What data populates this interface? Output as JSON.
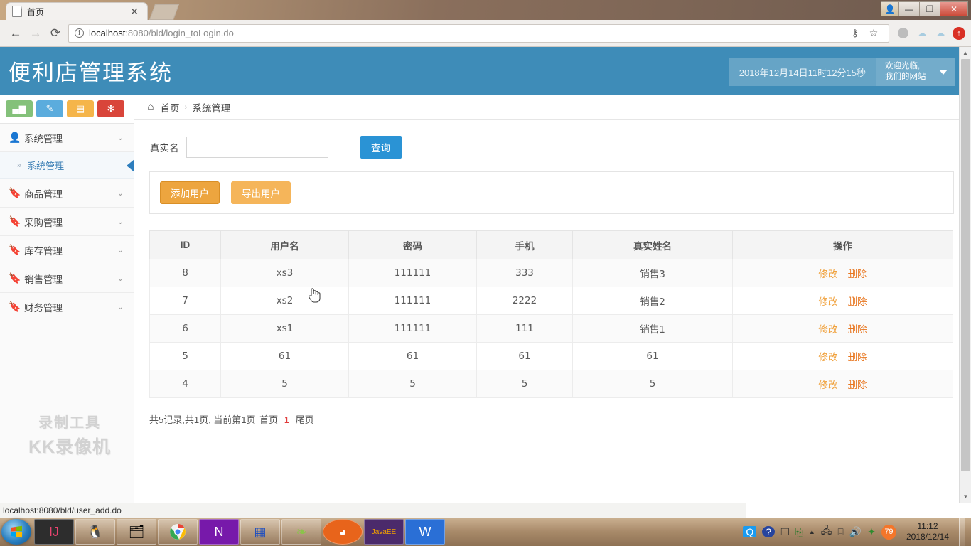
{
  "browser": {
    "tab_title": "首页",
    "tab_close": "✕",
    "back_icon": "←",
    "forward_icon": "→",
    "reload_icon": "⟳",
    "url_host": "localhost",
    "url_rest": ":8080/bld/login_toLogin.do",
    "key_icon": "⚷",
    "star_icon": "☆",
    "cloud_icon": "☁",
    "upload_icon": "↑",
    "minimize_icon": "—",
    "maximize_icon": "❐",
    "close_icon": "✕",
    "user_icon": "👤",
    "status_text": "localhost:8080/bld/user_add.do"
  },
  "header": {
    "title": "便利店管理系统",
    "datetime": "2018年12月14日11时12分15秒",
    "welcome_line1": "欢迎光临,",
    "welcome_line2": "我们的网站"
  },
  "sidebar": {
    "quick_icons": [
      {
        "name": "chart-icon",
        "glyph": "▮▬",
        "color": "#84c17a"
      },
      {
        "name": "pencil-icon",
        "glyph": "✎",
        "color": "#5bacdd"
      },
      {
        "name": "gift-icon",
        "glyph": "🎁",
        "color": "#f5b54a"
      },
      {
        "name": "gears-icon",
        "glyph": "✿",
        "color": "#d9453a"
      }
    ],
    "items": [
      {
        "label": "系统管理",
        "icon": "user-icon",
        "chevron": "⌄"
      },
      {
        "label": "商品管理",
        "icon": "bookmark-icon",
        "chevron": "⌄"
      },
      {
        "label": "采购管理",
        "icon": "bookmark-icon",
        "chevron": "⌄"
      },
      {
        "label": "库存管理",
        "icon": "bookmark-icon",
        "chevron": "⌄"
      },
      {
        "label": "销售管理",
        "icon": "bookmark-icon",
        "chevron": "⌄"
      },
      {
        "label": "财务管理",
        "icon": "bookmark-icon",
        "chevron": "⌄"
      }
    ],
    "sub_item": {
      "label": "系统管理",
      "arrow": "»"
    },
    "watermark_line1": "录制工具",
    "watermark_line2": "KK录像机"
  },
  "breadcrumb": {
    "home_icon": "⌂",
    "home": "首页",
    "separator": "›",
    "current": "系统管理"
  },
  "search": {
    "label": "真实名",
    "value": "",
    "placeholder": "",
    "button": "查询"
  },
  "toolbar": {
    "add_label": "添加用户",
    "export_label": "导出用户"
  },
  "table": {
    "headers": [
      "ID",
      "用户名",
      "密码",
      "手机",
      "真实姓名",
      "操作"
    ],
    "rows": [
      {
        "id": "8",
        "username": "xs3",
        "password": "111111",
        "phone": "333",
        "realname": "销售3"
      },
      {
        "id": "7",
        "username": "xs2",
        "password": "111111",
        "phone": "2222",
        "realname": "销售2"
      },
      {
        "id": "6",
        "username": "xs1",
        "password": "111111",
        "phone": "111",
        "realname": "销售1"
      },
      {
        "id": "5",
        "username": "61",
        "password": "61",
        "phone": "61",
        "realname": "61"
      },
      {
        "id": "4",
        "username": "5",
        "password": "5",
        "phone": "5",
        "realname": "5"
      }
    ],
    "action_edit": "修改",
    "action_delete": "删除"
  },
  "pager": {
    "summary": "共5记录,共1页, 当前第1页",
    "first": "首页",
    "current_page": "1",
    "last": "尾页"
  },
  "taskbar": {
    "start_icon": "⊞",
    "items": [
      {
        "name": "intellij-idea",
        "glyph": "IJ"
      },
      {
        "name": "qq",
        "glyph": "🐧"
      },
      {
        "name": "file-explorer",
        "glyph": "🗂"
      },
      {
        "name": "chrome",
        "glyph": "◉"
      },
      {
        "name": "onenote",
        "glyph": "N"
      },
      {
        "name": "navicat-tool",
        "glyph": "▦"
      },
      {
        "name": "mysql",
        "glyph": "🍃"
      },
      {
        "name": "browser-panda",
        "glyph": "◕"
      },
      {
        "name": "java-ee-ide",
        "glyph": "☸"
      },
      {
        "name": "wps",
        "glyph": "W"
      }
    ],
    "tray": {
      "q_icon": "Q",
      "help_icon": "?",
      "windows_icon": "❐",
      "usb_icon": "⎘",
      "up_icon": "▲",
      "network_icon": "🖧",
      "plug_icon": "🔌",
      "volume_icon": "🔊",
      "shield_icon": "✦",
      "badge": "79"
    },
    "clock_time": "11:12",
    "clock_date": "2018/12/14"
  },
  "colors": {
    "header_blue": "#3e8cb8",
    "accent_blue": "#2a93d5",
    "orange": "#f5b55a",
    "orange_hover": "#eda53f",
    "edit_link": "#f0a13c",
    "delete_link": "#e8761f",
    "current_page": "#e03b3b"
  }
}
